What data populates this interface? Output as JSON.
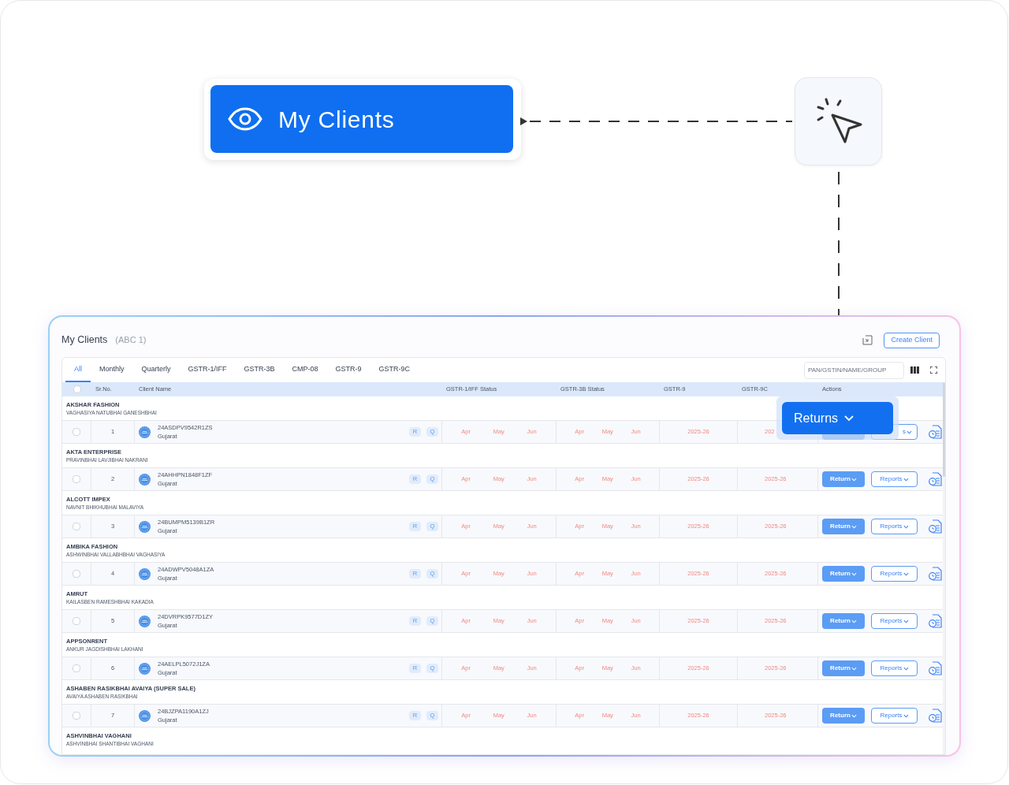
{
  "callout": {
    "label": "My Clients"
  },
  "panel": {
    "title": "My Clients",
    "subtitle": "(ABC 1)",
    "create_button": "Create Client",
    "tabs": [
      {
        "label": "All",
        "selected": true
      },
      {
        "label": "Monthly",
        "selected": false
      },
      {
        "label": "Quarterly",
        "selected": false
      },
      {
        "label": "GSTR-1/IFF",
        "selected": false
      },
      {
        "label": "GSTR-3B",
        "selected": false
      },
      {
        "label": "CMP-08",
        "selected": false
      },
      {
        "label": "GSTR-9",
        "selected": false
      },
      {
        "label": "GSTR-9C",
        "selected": false
      }
    ],
    "search": {
      "placeholder": "PAN/GSTIN/NAME/GROUP"
    },
    "header_checked": false,
    "columns": [
      "Sr.No.",
      "Client Name",
      "GSTR-1/IFF Status",
      "GSTR-3B Status",
      "GSTR-9",
      "GSTR-9C",
      "Actions"
    ],
    "groups": [
      {
        "name": "AKSHAR FASHION",
        "owner": "VAGHASIYA NATUBHAI GANESHBHAI",
        "row": {
          "checked": false,
          "sr": "1",
          "gstin": "24ASDPV9542R1ZS",
          "state": "Gujarat",
          "badges": [
            "R",
            "Q"
          ],
          "gstr1": [
            "Apr",
            "May",
            "Jun"
          ],
          "gstr3b": [
            "Apr",
            "May",
            "Jun"
          ],
          "gstr9": "2025-26",
          "gstr9c": "202",
          "reports": "s"
        }
      },
      {
        "name": "AKTA ENTERPRISE",
        "owner": "PRAVINBHAI LAVJIBHAI NAKRANI",
        "row": {
          "checked": false,
          "sr": "2",
          "gstin": "24AHHPN1848F1ZF",
          "state": "Gujarat",
          "badges": [
            "R",
            "Q"
          ],
          "gstr1": [
            "Apr",
            "May",
            "Jun"
          ],
          "gstr3b": [
            "Apr",
            "May",
            "Jun"
          ],
          "gstr9": "2025-26",
          "gstr9c": "2025-26",
          "return": "Return",
          "reports": "Reports"
        }
      },
      {
        "name": "ALCOTT IMPEX",
        "owner": "NAVNIT BHIKHUBHAI MALAVIYA",
        "row": {
          "checked": false,
          "sr": "3",
          "gstin": "24BUMPM5139B1ZR",
          "state": "Gujarat",
          "badges": [
            "R",
            "Q"
          ],
          "gstr1": [
            "Apr",
            "May",
            "Jun"
          ],
          "gstr3b": [
            "Apr",
            "May",
            "Jun"
          ],
          "gstr9": "2025-26",
          "gstr9c": "2025-26",
          "return": "Return",
          "reports": "Reports"
        }
      },
      {
        "name": "AMBIKA FASHION",
        "owner": "ASHWINBHAI VALLABHBHAI VAGHASIYA",
        "row": {
          "checked": false,
          "sr": "4",
          "gstin": "24ADWPV5048A1ZA",
          "state": "Gujarat",
          "badges": [
            "R",
            "Q"
          ],
          "gstr1": [
            "Apr",
            "May",
            "Jun"
          ],
          "gstr3b": [
            "Apr",
            "May",
            "Jun"
          ],
          "gstr9": "2025-26",
          "gstr9c": "2025-26",
          "return": "Return",
          "reports": "Reports"
        }
      },
      {
        "name": "AMRUT",
        "owner": "KAILASBEN RAMESHBHAI KAKADIA",
        "row": {
          "checked": false,
          "sr": "5",
          "gstin": "24DVRPK9577D1ZY",
          "state": "Gujarat",
          "badges": [
            "R",
            "Q"
          ],
          "gstr1": [
            "Apr",
            "May",
            "Jun"
          ],
          "gstr3b": [
            "Apr",
            "May",
            "Jun"
          ],
          "gstr9": "2025-26",
          "gstr9c": "2025-26",
          "return": "Return",
          "reports": "Reports"
        }
      },
      {
        "name": "APPSONRENT",
        "owner": "ANKUR JAGDISHBHAI LAKHANI",
        "row": {
          "checked": false,
          "sr": "6",
          "gstin": "24AELPL5072J1ZA",
          "state": "Gujarat",
          "badges": [
            "R",
            "Q"
          ],
          "gstr1": [
            "Apr",
            "May",
            "Jun"
          ],
          "gstr3b": [
            "Apr",
            "May",
            "Jun"
          ],
          "gstr9": "2025-26",
          "gstr9c": "2025-26",
          "return": "Return",
          "reports": "Reports"
        }
      },
      {
        "name": "ASHABEN RASIKBHAI AVAIYA (SUPER SALE)",
        "owner": "AVAIYA ASHABEN RASIKBHAI",
        "row": {
          "checked": false,
          "sr": "7",
          "gstin": "24BJZPA1190A1ZJ",
          "state": "Gujarat",
          "badges": [
            "R",
            "Q"
          ],
          "gstr1": [
            "Apr",
            "May",
            "Jun"
          ],
          "gstr3b": [
            "Apr",
            "May",
            "Jun"
          ],
          "gstr9": "2025-26",
          "gstr9c": "2025-26",
          "return": "Return",
          "reports": "Reports"
        }
      },
      {
        "name": "ASHVINBHAI VAGHANI",
        "owner": "ASHVINBHAI SHANTIBHAI VAGHANI"
      }
    ]
  },
  "popup": {
    "label": "Returns"
  }
}
